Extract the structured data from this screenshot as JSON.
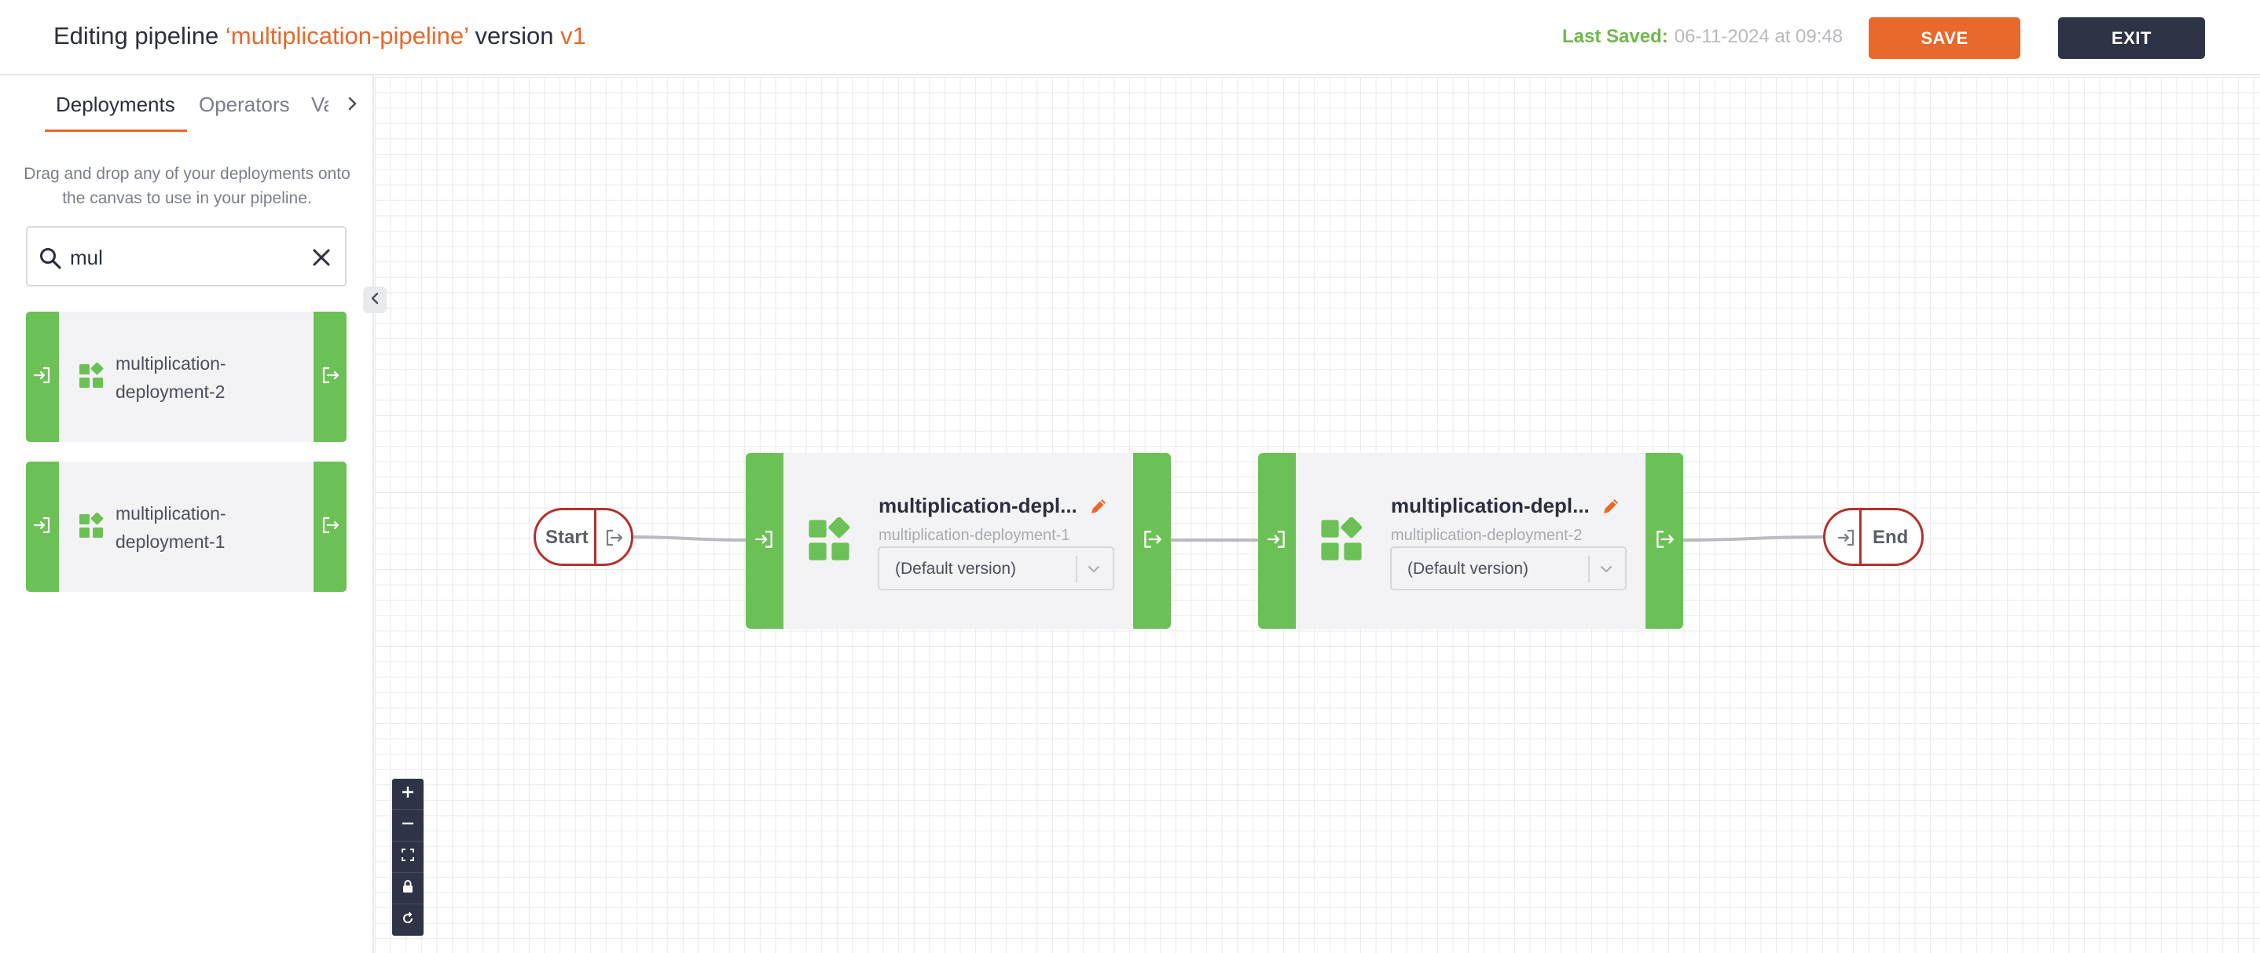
{
  "header": {
    "title_prefix": "Editing pipeline ",
    "pipeline_name": "‘multiplication-pipeline’",
    "title_middle": " version ",
    "version": "v1",
    "last_saved_label": "Last Saved:",
    "last_saved_value": "06-11-2024 at 09:48",
    "save_label": "SAVE",
    "exit_label": "EXIT"
  },
  "sidebar": {
    "tabs": [
      {
        "label": "Deployments",
        "active": true
      },
      {
        "label": "Operators",
        "active": false
      },
      {
        "label": "Va",
        "active": false
      }
    ],
    "help_text": "Drag and drop any of your deployments onto the canvas to use in your pipeline.",
    "search": {
      "value": "mul",
      "placeholder": ""
    },
    "deployments": [
      {
        "name": "multiplication-deployment-2"
      },
      {
        "name": "multiplication-deployment-1"
      }
    ]
  },
  "canvas": {
    "start_label": "Start",
    "end_label": "End",
    "nodes": [
      {
        "title": "multiplication-depl...",
        "subtitle": "multiplication-deployment-1",
        "version": "(Default version)"
      },
      {
        "title": "multiplication-depl...",
        "subtitle": "multiplication-deployment-2",
        "version": "(Default version)"
      }
    ]
  },
  "colors": {
    "accent": "#e9682b",
    "dark": "#2e3446",
    "node_green": "#6bc155",
    "endpoint_red": "#b3312e",
    "saved_green": "#6fb84c"
  },
  "icons": [
    "search-icon",
    "clear-icon",
    "chevron-right-icon",
    "chevron-left-icon",
    "input-port-icon",
    "output-port-icon",
    "deployment-icon",
    "edit-pencil-icon",
    "chevron-down-icon",
    "zoom-in-icon",
    "zoom-out-icon",
    "fit-view-icon",
    "lock-icon",
    "reset-icon"
  ]
}
